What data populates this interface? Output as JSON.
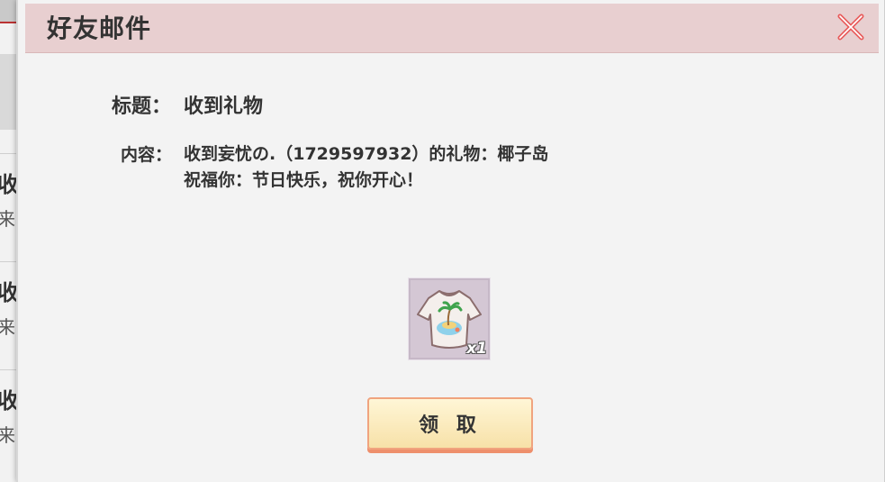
{
  "background": {
    "rows": [
      {
        "t1": "收",
        "t2": "来"
      },
      {
        "t1": "收",
        "t2": "来"
      },
      {
        "t1": "收",
        "t2": "来"
      }
    ]
  },
  "dialog": {
    "title": "好友邮件",
    "close_icon": "close-icon",
    "subject_label": "标题：",
    "subject_value": "收到礼物",
    "content_label": "内容：",
    "content_line1": "收到妄忧の.（1729597932）的礼物：椰子岛",
    "content_line2": "祝福你：节日快乐，祝你开心！",
    "item": {
      "icon": "tshirt-coconut-island-icon",
      "count": "x1"
    },
    "claim_label": "领 取",
    "colors": {
      "title_bar": "#e8cfd0",
      "button_border": "#f0a37e",
      "close_x": "#e85a5a"
    }
  }
}
